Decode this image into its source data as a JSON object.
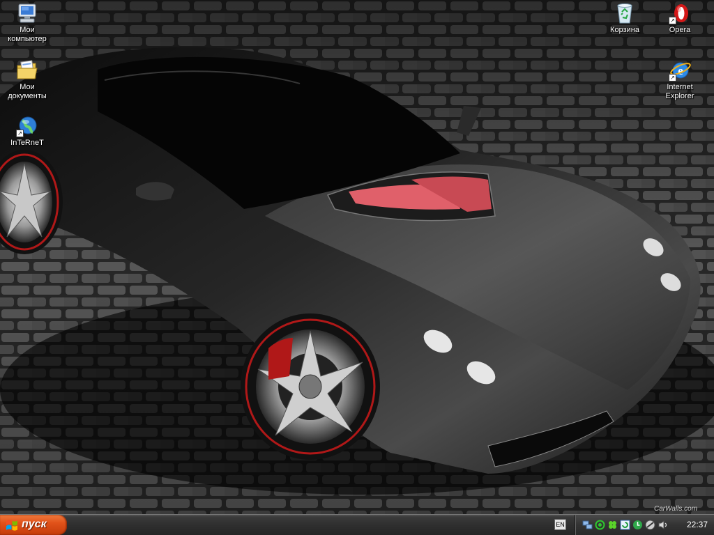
{
  "desktop": {
    "icons": [
      {
        "label": "Мои\nкомпьютер",
        "icon": "my-computer-icon"
      },
      {
        "label": "Мои\nдокументы",
        "icon": "my-documents-icon"
      },
      {
        "label": "InTeRneT",
        "icon": "internet-shortcut-icon"
      },
      {
        "label": "Корзина",
        "icon": "recycle-bin-icon"
      },
      {
        "label": "Opera",
        "icon": "opera-icon"
      },
      {
        "label": "Internet\nExplorer",
        "icon": "internet-explorer-icon"
      }
    ],
    "wallpaper": {
      "watermark": "CarWalls.com",
      "colors": {
        "car": "#1a1a1a",
        "intake": "#e0606a",
        "stones": "#5e5e5e",
        "brake": "#b01818"
      }
    }
  },
  "taskbar": {
    "start_label": "пуск",
    "language": "EN",
    "tray_icons": [
      "network-icon",
      "messenger-icon",
      "clover-icon",
      "sync-icon",
      "update-icon",
      "antivirus-icon",
      "volume-icon"
    ],
    "clock": "22:37",
    "colors": {
      "start": "#e1521a",
      "bar": "#2e2e2e"
    }
  }
}
